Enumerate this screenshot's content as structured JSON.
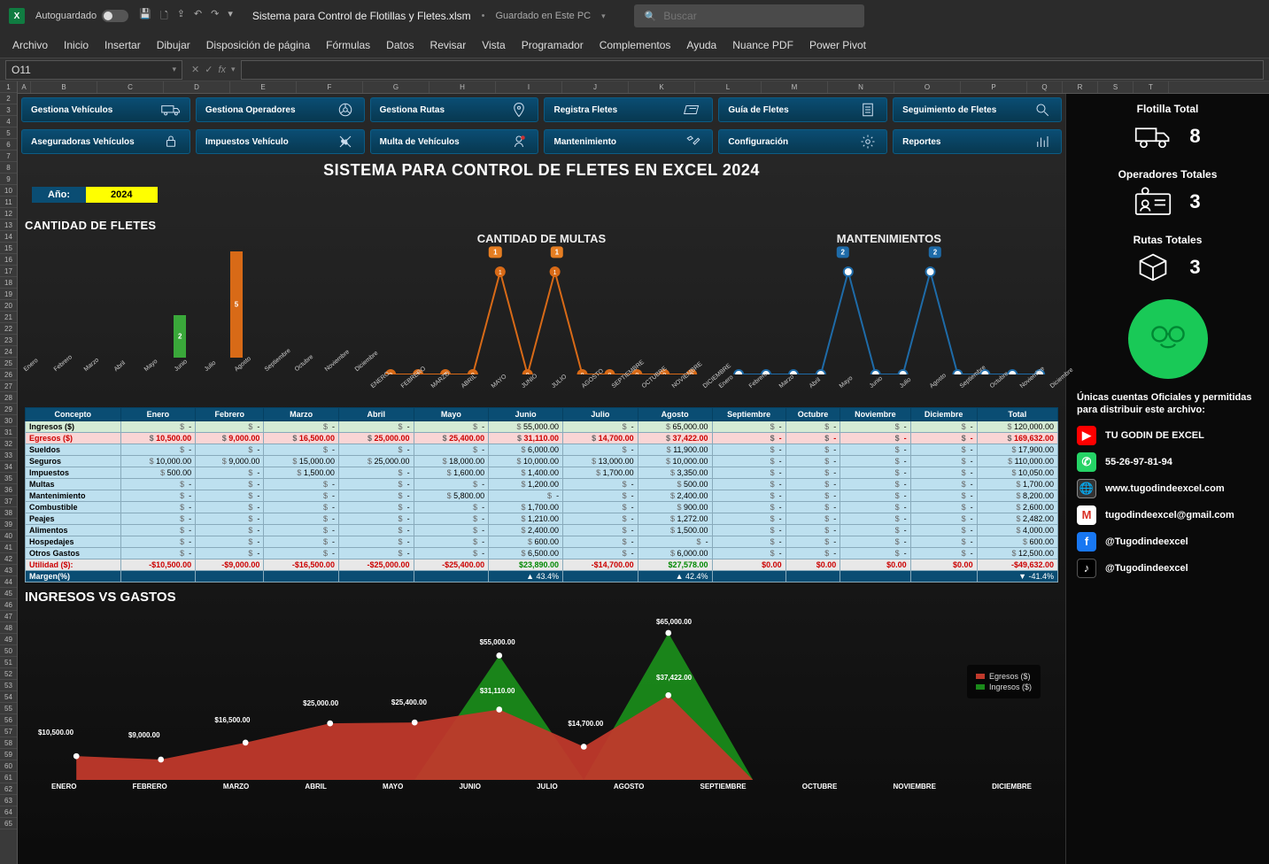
{
  "titlebar": {
    "autosave": "Autoguardado",
    "filename": "Sistema para Control de Flotillas y Fletes.xlsm",
    "saveloc": "Guardado en Este PC",
    "search_ph": "Buscar"
  },
  "ribbon": [
    "Archivo",
    "Inicio",
    "Insertar",
    "Dibujar",
    "Disposición de página",
    "Fórmulas",
    "Datos",
    "Revisar",
    "Vista",
    "Programador",
    "Complementos",
    "Ayuda",
    "Nuance PDF",
    "Power Pivot"
  ],
  "namebox": "O11",
  "colheaders": [
    "A",
    "B",
    "C",
    "D",
    "E",
    "F",
    "G",
    "H",
    "I",
    "J",
    "K",
    "L",
    "M",
    "N",
    "O",
    "P",
    "Q",
    "R",
    "S",
    "T"
  ],
  "buttons": {
    "r1": [
      "Gestiona Vehículos",
      "Gestiona Operadores",
      "Gestiona Rutas",
      "Registra Fletes",
      "Guía de Fletes",
      "Seguimiento de Fletes"
    ],
    "r2": [
      "Aseguradoras Vehículos",
      "Impuestos Vehículo",
      "Multa de Vehículos",
      "Mantenimiento",
      "Configuración",
      "Reportes"
    ]
  },
  "dash_title": "SISTEMA PARA CONTROL DE FLETES EN EXCEL 2024",
  "year_label": "Año:",
  "year_value": "2024",
  "sec_fletes": "CANTIDAD  DE FLETES",
  "sec_multas": "CANTIDAD DE MULTAS",
  "sec_mant": "MANTENIMIENTOS",
  "sec_ivg": "INGRESOS VS GASTOS",
  "months_short": [
    "Enero",
    "Febrero",
    "Marzo",
    "Abril",
    "Mayo",
    "Junio",
    "Julio",
    "Agosto",
    "Septiembre",
    "Octubre",
    "Noviembre",
    "Diciembre"
  ],
  "months_up": [
    "ENERO",
    "FEBRERO",
    "MARZO",
    "ABRIL",
    "MAYO",
    "JUNIO",
    "JULIO",
    "AGOSTO",
    "SEPTIEMBRE",
    "OCTUBRE",
    "NOVIEMBRE",
    "DICIEMBRE"
  ],
  "stats": {
    "flotilla_t": "Flotilla Total",
    "flotilla_v": "8",
    "oper_t": "Operadores Totales",
    "oper_v": "3",
    "rutas_t": "Rutas Totales",
    "rutas_v": "3"
  },
  "official": "Únicas cuentas Oficiales y permitidas para distribuir este archivo:",
  "socials": {
    "yt": "TU GODIN DE EXCEL",
    "wa": "55-26-97-81-94",
    "web": "www.tugodindeexcel.com",
    "gm": "tugodindeexcel@gmail.com",
    "fb": "@Tugodindeexcel",
    "tk": "@Tugodindeexcel"
  },
  "legend": {
    "egr": "Egresos ($)",
    "ing": "Ingresos ($)"
  },
  "table": {
    "headers": [
      "Concepto",
      "Enero",
      "Febrero",
      "Marzo",
      "Abril",
      "Mayo",
      "Junio",
      "Julio",
      "Agosto",
      "Septiembre",
      "Octubre",
      "Noviembre",
      "Diciembre",
      "Total"
    ],
    "rows": [
      {
        "c": "Ingresos ($)",
        "cls": "ing",
        "v": [
          "-",
          "-",
          "-",
          "-",
          "-",
          "55,000.00",
          "-",
          "65,000.00",
          "-",
          "-",
          "-",
          "-",
          "120,000.00"
        ]
      },
      {
        "c": "Egresos ($)",
        "cls": "egr",
        "v": [
          "10,500.00",
          "9,000.00",
          "16,500.00",
          "25,000.00",
          "25,400.00",
          "31,110.00",
          "14,700.00",
          "37,422.00",
          "-",
          "-",
          "-",
          "-",
          "169,632.00"
        ]
      },
      {
        "c": "Sueldos",
        "cls": "",
        "v": [
          "-",
          "-",
          "-",
          "-",
          "-",
          "6,000.00",
          "-",
          "11,900.00",
          "-",
          "-",
          "-",
          "-",
          "17,900.00"
        ]
      },
      {
        "c": "Seguros",
        "cls": "",
        "v": [
          "10,000.00",
          "9,000.00",
          "15,000.00",
          "25,000.00",
          "18,000.00",
          "10,000.00",
          "13,000.00",
          "10,000.00",
          "-",
          "-",
          "-",
          "-",
          "110,000.00"
        ]
      },
      {
        "c": "Impuestos",
        "cls": "",
        "v": [
          "500.00",
          "-",
          "1,500.00",
          "-",
          "1,600.00",
          "1,400.00",
          "1,700.00",
          "3,350.00",
          "-",
          "-",
          "-",
          "-",
          "10,050.00"
        ]
      },
      {
        "c": "Multas",
        "cls": "",
        "v": [
          "-",
          "-",
          "-",
          "-",
          "-",
          "1,200.00",
          "-",
          "500.00",
          "-",
          "-",
          "-",
          "-",
          "1,700.00"
        ]
      },
      {
        "c": "Mantenimiento",
        "cls": "",
        "v": [
          "-",
          "-",
          "-",
          "-",
          "5,800.00",
          "-",
          "-",
          "2,400.00",
          "-",
          "-",
          "-",
          "-",
          "8,200.00"
        ]
      },
      {
        "c": "Combustible",
        "cls": "",
        "v": [
          "-",
          "-",
          "-",
          "-",
          "-",
          "1,700.00",
          "-",
          "900.00",
          "-",
          "-",
          "-",
          "-",
          "2,600.00"
        ]
      },
      {
        "c": "Peajes",
        "cls": "",
        "v": [
          "-",
          "-",
          "-",
          "-",
          "-",
          "1,210.00",
          "-",
          "1,272.00",
          "-",
          "-",
          "-",
          "-",
          "2,482.00"
        ]
      },
      {
        "c": "Alimentos",
        "cls": "",
        "v": [
          "-",
          "-",
          "-",
          "-",
          "-",
          "2,400.00",
          "-",
          "1,500.00",
          "-",
          "-",
          "-",
          "-",
          "4,000.00"
        ]
      },
      {
        "c": "Hospedajes",
        "cls": "",
        "v": [
          "-",
          "-",
          "-",
          "-",
          "-",
          "600.00",
          "-",
          "-",
          "-",
          "-",
          "-",
          "-",
          "600.00"
        ]
      },
      {
        "c": "Otros Gastos",
        "cls": "",
        "v": [
          "-",
          "-",
          "-",
          "-",
          "-",
          "6,500.00",
          "-",
          "6,000.00",
          "-",
          "-",
          "-",
          "-",
          "12,500.00"
        ]
      },
      {
        "c": "Utilidad ($):",
        "cls": "util",
        "v": [
          "-$10,500.00",
          "-$9,000.00",
          "-$16,500.00",
          "-$25,000.00",
          "-$25,400.00",
          "$23,890.00",
          "-$14,700.00",
          "$27,578.00",
          "$0.00",
          "$0.00",
          "$0.00",
          "$0.00",
          "-$49,632.00"
        ]
      },
      {
        "c": "Margen(%)",
        "cls": "marg",
        "v": [
          "",
          "",
          "",
          "",
          "",
          "▲ 43.4%",
          "",
          "▲ 42.4%",
          "",
          "",
          "",
          "",
          "▼ -41.4%"
        ]
      }
    ]
  },
  "chart_data": [
    {
      "type": "bar",
      "title": "CANTIDAD DE FLETES",
      "categories": [
        "Enero",
        "Febrero",
        "Marzo",
        "Abril",
        "Mayo",
        "Junio",
        "Julio",
        "Agosto",
        "Septiembre",
        "Octubre",
        "Noviembre",
        "Diciembre"
      ],
      "values": [
        0,
        0,
        0,
        0,
        0,
        2,
        0,
        5,
        0,
        0,
        0,
        0
      ],
      "colors": {
        "6": "#3aa83a",
        "8": "#d86a17"
      }
    },
    {
      "type": "line",
      "title": "CANTIDAD DE MULTAS",
      "categories": [
        "ENERO",
        "FEBRERO",
        "MARZO",
        "ABRIL",
        "MAYO",
        "JUNIO",
        "JULIO",
        "AGOSTO",
        "SEPTIEMBRE",
        "OCTUBRE",
        "NOVIEMBRE",
        "DICIEMBRE"
      ],
      "values": [
        0,
        0,
        0,
        0,
        1,
        0,
        1,
        0,
        0,
        0,
        0,
        0
      ],
      "color": "#d86a17"
    },
    {
      "type": "line",
      "title": "MANTENIMIENTOS",
      "categories": [
        "Enero",
        "Febrero",
        "Marzo",
        "Abril",
        "Mayo",
        "Junio",
        "Julio",
        "Agosto",
        "Septiembre",
        "Octubre",
        "Noviembre",
        "Diciembre"
      ],
      "values": [
        0,
        0,
        0,
        0,
        2,
        0,
        0,
        2,
        0,
        0,
        0,
        0
      ],
      "color": "#1e6ba8"
    },
    {
      "type": "area",
      "title": "INGRESOS VS GASTOS",
      "categories": [
        "ENERO",
        "FEBRERO",
        "MARZO",
        "ABRIL",
        "MAYO",
        "JUNIO",
        "JULIO",
        "AGOSTO",
        "SEPTIEMBRE",
        "OCTUBRE",
        "NOVIEMBRE",
        "DICIEMBRE"
      ],
      "series": [
        {
          "name": "Egresos ($)",
          "color": "#c0392b",
          "values": [
            10500,
            9000,
            16500,
            25000,
            25400,
            31110,
            14700,
            37422,
            0,
            0,
            0,
            0
          ],
          "labels": [
            "$10,500.00",
            "$9,000.00",
            "$16,500.00",
            "$25,000.00",
            "$25,400.00",
            "$31,110.00",
            "$14,700.00",
            "$37,422.00",
            "",
            "",
            "",
            ""
          ]
        },
        {
          "name": "Ingresos ($)",
          "color": "#1a8a1a",
          "values": [
            0,
            0,
            0,
            0,
            0,
            55000,
            0,
            65000,
            0,
            0,
            0,
            0
          ],
          "labels": [
            "",
            "",
            "",
            "",
            "",
            "$55,000.00",
            "",
            "$65,000.00",
            "",
            "",
            "",
            ""
          ]
        }
      ],
      "ylim": [
        0,
        70000
      ]
    }
  ]
}
